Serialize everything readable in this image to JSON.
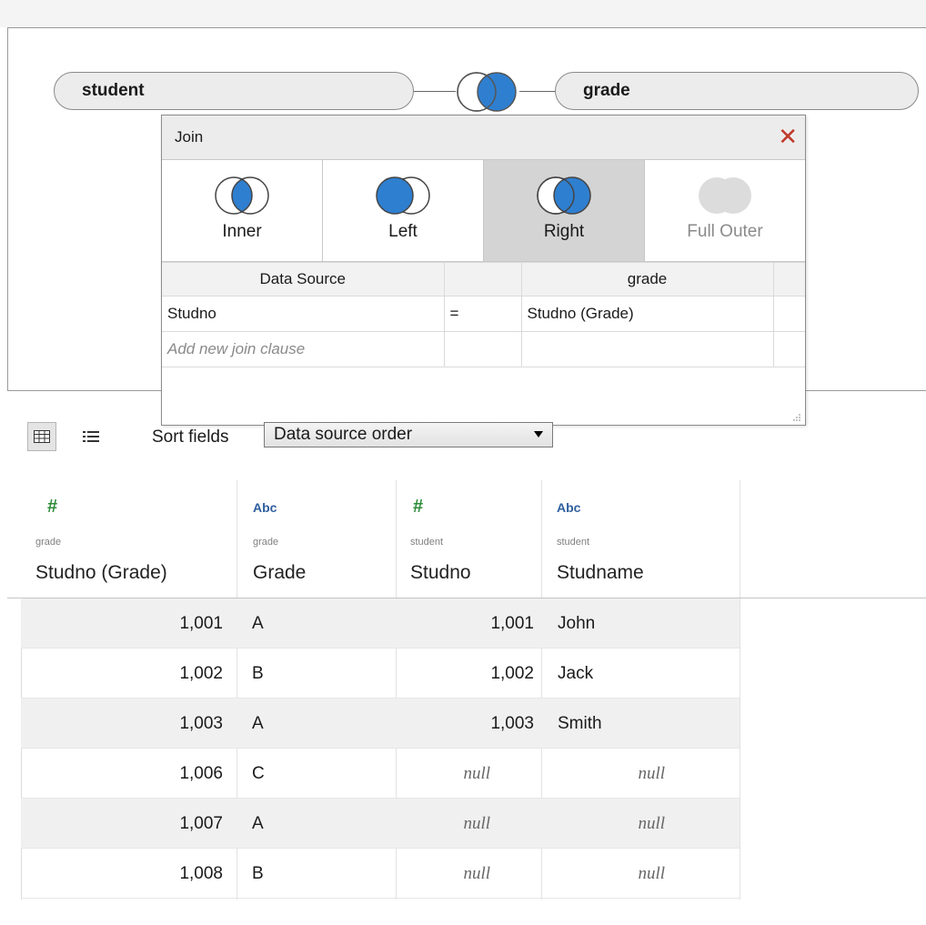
{
  "join_canvas": {
    "left_table": "student",
    "right_table": "grade",
    "join_icon": "right-join-venn-icon"
  },
  "join_dialog": {
    "title": "Join",
    "close_icon": "close-icon",
    "join_types": [
      {
        "label": "Inner",
        "icon": "inner-join-icon",
        "selected": false,
        "disabled": false
      },
      {
        "label": "Left",
        "icon": "left-join-icon",
        "selected": false,
        "disabled": false
      },
      {
        "label": "Right",
        "icon": "right-join-icon",
        "selected": true,
        "disabled": false
      },
      {
        "label": "Full Outer",
        "icon": "full-outer-join-icon",
        "selected": false,
        "disabled": true
      }
    ],
    "clause_headers": {
      "left": "Data Source",
      "operator": "",
      "right": "grade"
    },
    "clauses": [
      {
        "left": "Studno",
        "operator": "=",
        "right": "Studno (Grade)"
      }
    ],
    "add_clause_placeholder": "Add new join clause"
  },
  "toolbar": {
    "grid_view_icon": "grid-view-icon",
    "list_view_icon": "list-view-icon",
    "sort_label": "Sort fields",
    "sort_value": "Data source order"
  },
  "grid": {
    "columns": [
      {
        "type_label": "#",
        "type": "number",
        "source": "grade",
        "name": "Studno (Grade)"
      },
      {
        "type_label": "Abc",
        "type": "string",
        "source": "grade",
        "name": "Grade"
      },
      {
        "type_label": "#",
        "type": "number",
        "source": "student",
        "name": "Studno"
      },
      {
        "type_label": "Abc",
        "type": "string",
        "source": "student",
        "name": "Studname"
      }
    ],
    "rows": [
      [
        "1,001",
        "A",
        "1,001",
        "John"
      ],
      [
        "1,002",
        "B",
        "1,002",
        "Jack"
      ],
      [
        "1,003",
        "A",
        "1,003",
        "Smith"
      ],
      [
        "1,006",
        "C",
        "null",
        "null"
      ],
      [
        "1,007",
        "A",
        "null",
        "null"
      ],
      [
        "1,008",
        "B",
        "null",
        "null"
      ]
    ]
  },
  "colors": {
    "venn_fill": "#2f7fd0",
    "venn_disabled": "#dcdcdc",
    "close": "#c0392b",
    "number_type": "#2e8b3a",
    "string_type": "#2f5f9e"
  }
}
